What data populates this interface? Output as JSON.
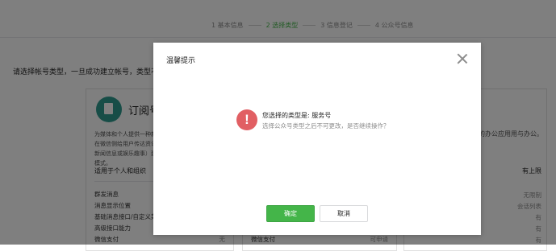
{
  "steps": [
    {
      "label": "1 基本信息",
      "active": false
    },
    {
      "label": "2 选择类型",
      "active": true
    },
    {
      "label": "3 信息登记",
      "active": false
    },
    {
      "label": "4 公众号信息",
      "active": false
    }
  ],
  "prompt": "请选择帐号类型，一旦成功建立帐号，类型不",
  "cards": {
    "left": {
      "title": "订阅号",
      "desc": "为媒体和个人提供一种新的信息传播方式，主要功能是在微信侧给用户传达资讯；（功能类似报纸杂志，提供新闻信息或娱乐趣事）建与读者之间更好的沟通与管理模式。",
      "subtitle": "适用于个人和组织",
      "features": [
        {
          "name": "群发消息",
          "value": ""
        },
        {
          "name": "消息显示位置",
          "value": ""
        },
        {
          "name": "基础消息接口/自定义菜单",
          "value": ""
        },
        {
          "name": "高级接口能力",
          "value": ""
        },
        {
          "name": "微信支付",
          "value": "无"
        }
      ]
    },
    "middle": {
      "features": [
        {
          "name": "微信支付",
          "value": "可申请"
        }
      ]
    },
    "right": {
      "desc": "丰富的办公应用用与办公。",
      "subtitle": "有上限",
      "values": [
        "无限制",
        "会话列表",
        "有",
        "有",
        "有"
      ]
    }
  },
  "dialog": {
    "title": "温馨提示",
    "message": "您选择的类型是: 服务号",
    "submessage": "选择公众号类型之后不可更改，是否继续操作？",
    "ok_label": "确定",
    "cancel_label": "取消",
    "warn_glyph": "!"
  },
  "colors": {
    "accent": "#44b549",
    "warning": "#e15f63",
    "overlay": "rgba(0,0,0,0.5)"
  }
}
